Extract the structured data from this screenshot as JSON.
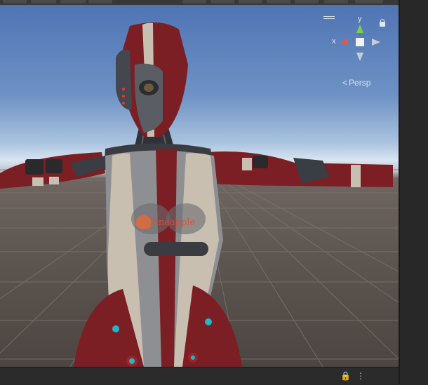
{
  "viewport": {
    "gizmo": {
      "x_label": "x",
      "y_label": "y"
    },
    "projection_label": "Persp",
    "projection_arrow": "<",
    "chest_logo_text": "Pineapple",
    "icons": [
      "menu-lines-icon",
      "lock-icon",
      "orientation-gizmo",
      "robot-character"
    ]
  },
  "bottom_bar": {
    "lock_icon": "🔒",
    "more_icon": "⋮"
  },
  "colors": {
    "sky_top": "#4f74b3",
    "ground": "#5d5550",
    "robot_red": "#7b1f24",
    "robot_cream": "#c8bfb0",
    "gizmo_x": "#e05a47",
    "gizmo_y": "#79d04a"
  }
}
